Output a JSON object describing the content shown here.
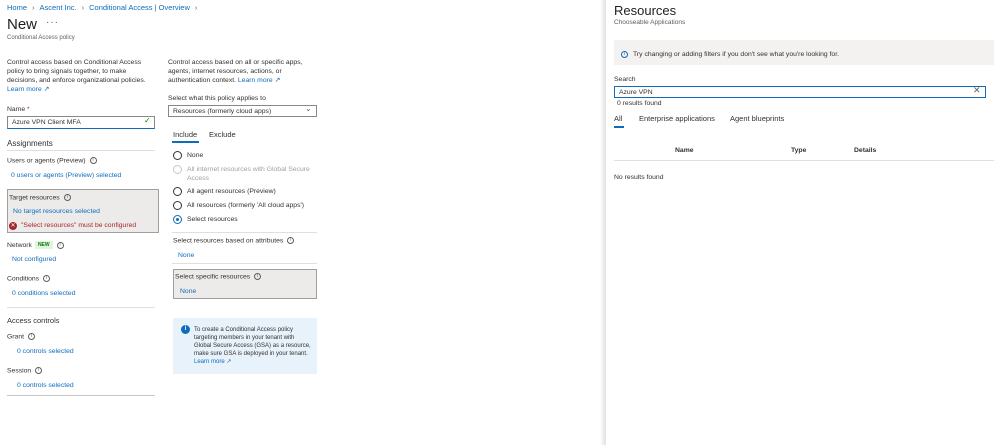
{
  "breadcrumb": [
    "Home",
    "Ascent Inc.",
    "Conditional Access | Overview"
  ],
  "page": {
    "title": "New",
    "more": "···",
    "subtitle": "Conditional Access policy"
  },
  "left": {
    "description": "Control access based on Conditional Access policy to bring signals together, to make decisions, and enforce organizational policies.",
    "learn_more": "Learn more",
    "name_label": "Name",
    "name_required": "*",
    "name_value": "Azure VPN Client MFA",
    "assignments": "Assignments",
    "users": {
      "label": "Users or agents (Preview)",
      "value": "0 users or agents (Preview) selected"
    },
    "target": {
      "label": "Target resources",
      "value": "No target resources selected",
      "error": "\"Select resources\" must be configured"
    },
    "network": {
      "label": "Network",
      "badge": "NEW",
      "value": "Not configured"
    },
    "conditions": {
      "label": "Conditions",
      "value": "0 conditions selected"
    },
    "access_controls": "Access controls",
    "grant": {
      "label": "Grant",
      "value": "0 controls selected"
    },
    "session": {
      "label": "Session",
      "value": "0 controls selected"
    }
  },
  "middle": {
    "description": "Control access based on all or specific apps, agents, internet resources, actions, or authentication context.",
    "learn_more": "Learn more",
    "applies_label": "Select what this policy applies to",
    "applies_value": "Resources (formerly cloud apps)",
    "tabs": [
      "Include",
      "Exclude"
    ],
    "options": [
      {
        "label": "None",
        "state": "normal"
      },
      {
        "label": "All internet resources with Global Secure Access",
        "state": "disabled"
      },
      {
        "label": "All agent resources (Preview)",
        "state": "normal"
      },
      {
        "label": "All resources (formerly 'All cloud apps')",
        "state": "normal"
      },
      {
        "label": "Select resources",
        "state": "selected"
      }
    ],
    "attributes_label": "Select resources based on attributes",
    "attributes_value": "None",
    "specific_label": "Select specific resources",
    "specific_value": "None",
    "info_text": "To create a Conditional Access policy targeting members in your tenant with Global Secure Access (GSA) as a resource, make sure GSA is deployed in your tenant.",
    "info_learn_more": "Learn more"
  },
  "panel": {
    "title": "Resources",
    "subtitle": "Chooseable Applications",
    "banner": "Try changing or adding filters if you don't see what you're looking for.",
    "search_label": "Search",
    "search_value": "Azure VPN",
    "results_count": "0 results found",
    "tabs": [
      "All",
      "Enterprise applications",
      "Agent blueprints"
    ],
    "columns": [
      "Name",
      "Type",
      "Details"
    ],
    "empty_message": "No results found"
  },
  "colors": {
    "accent": "#0f6cbd",
    "error": "#a4262c",
    "success": "#107c10"
  }
}
